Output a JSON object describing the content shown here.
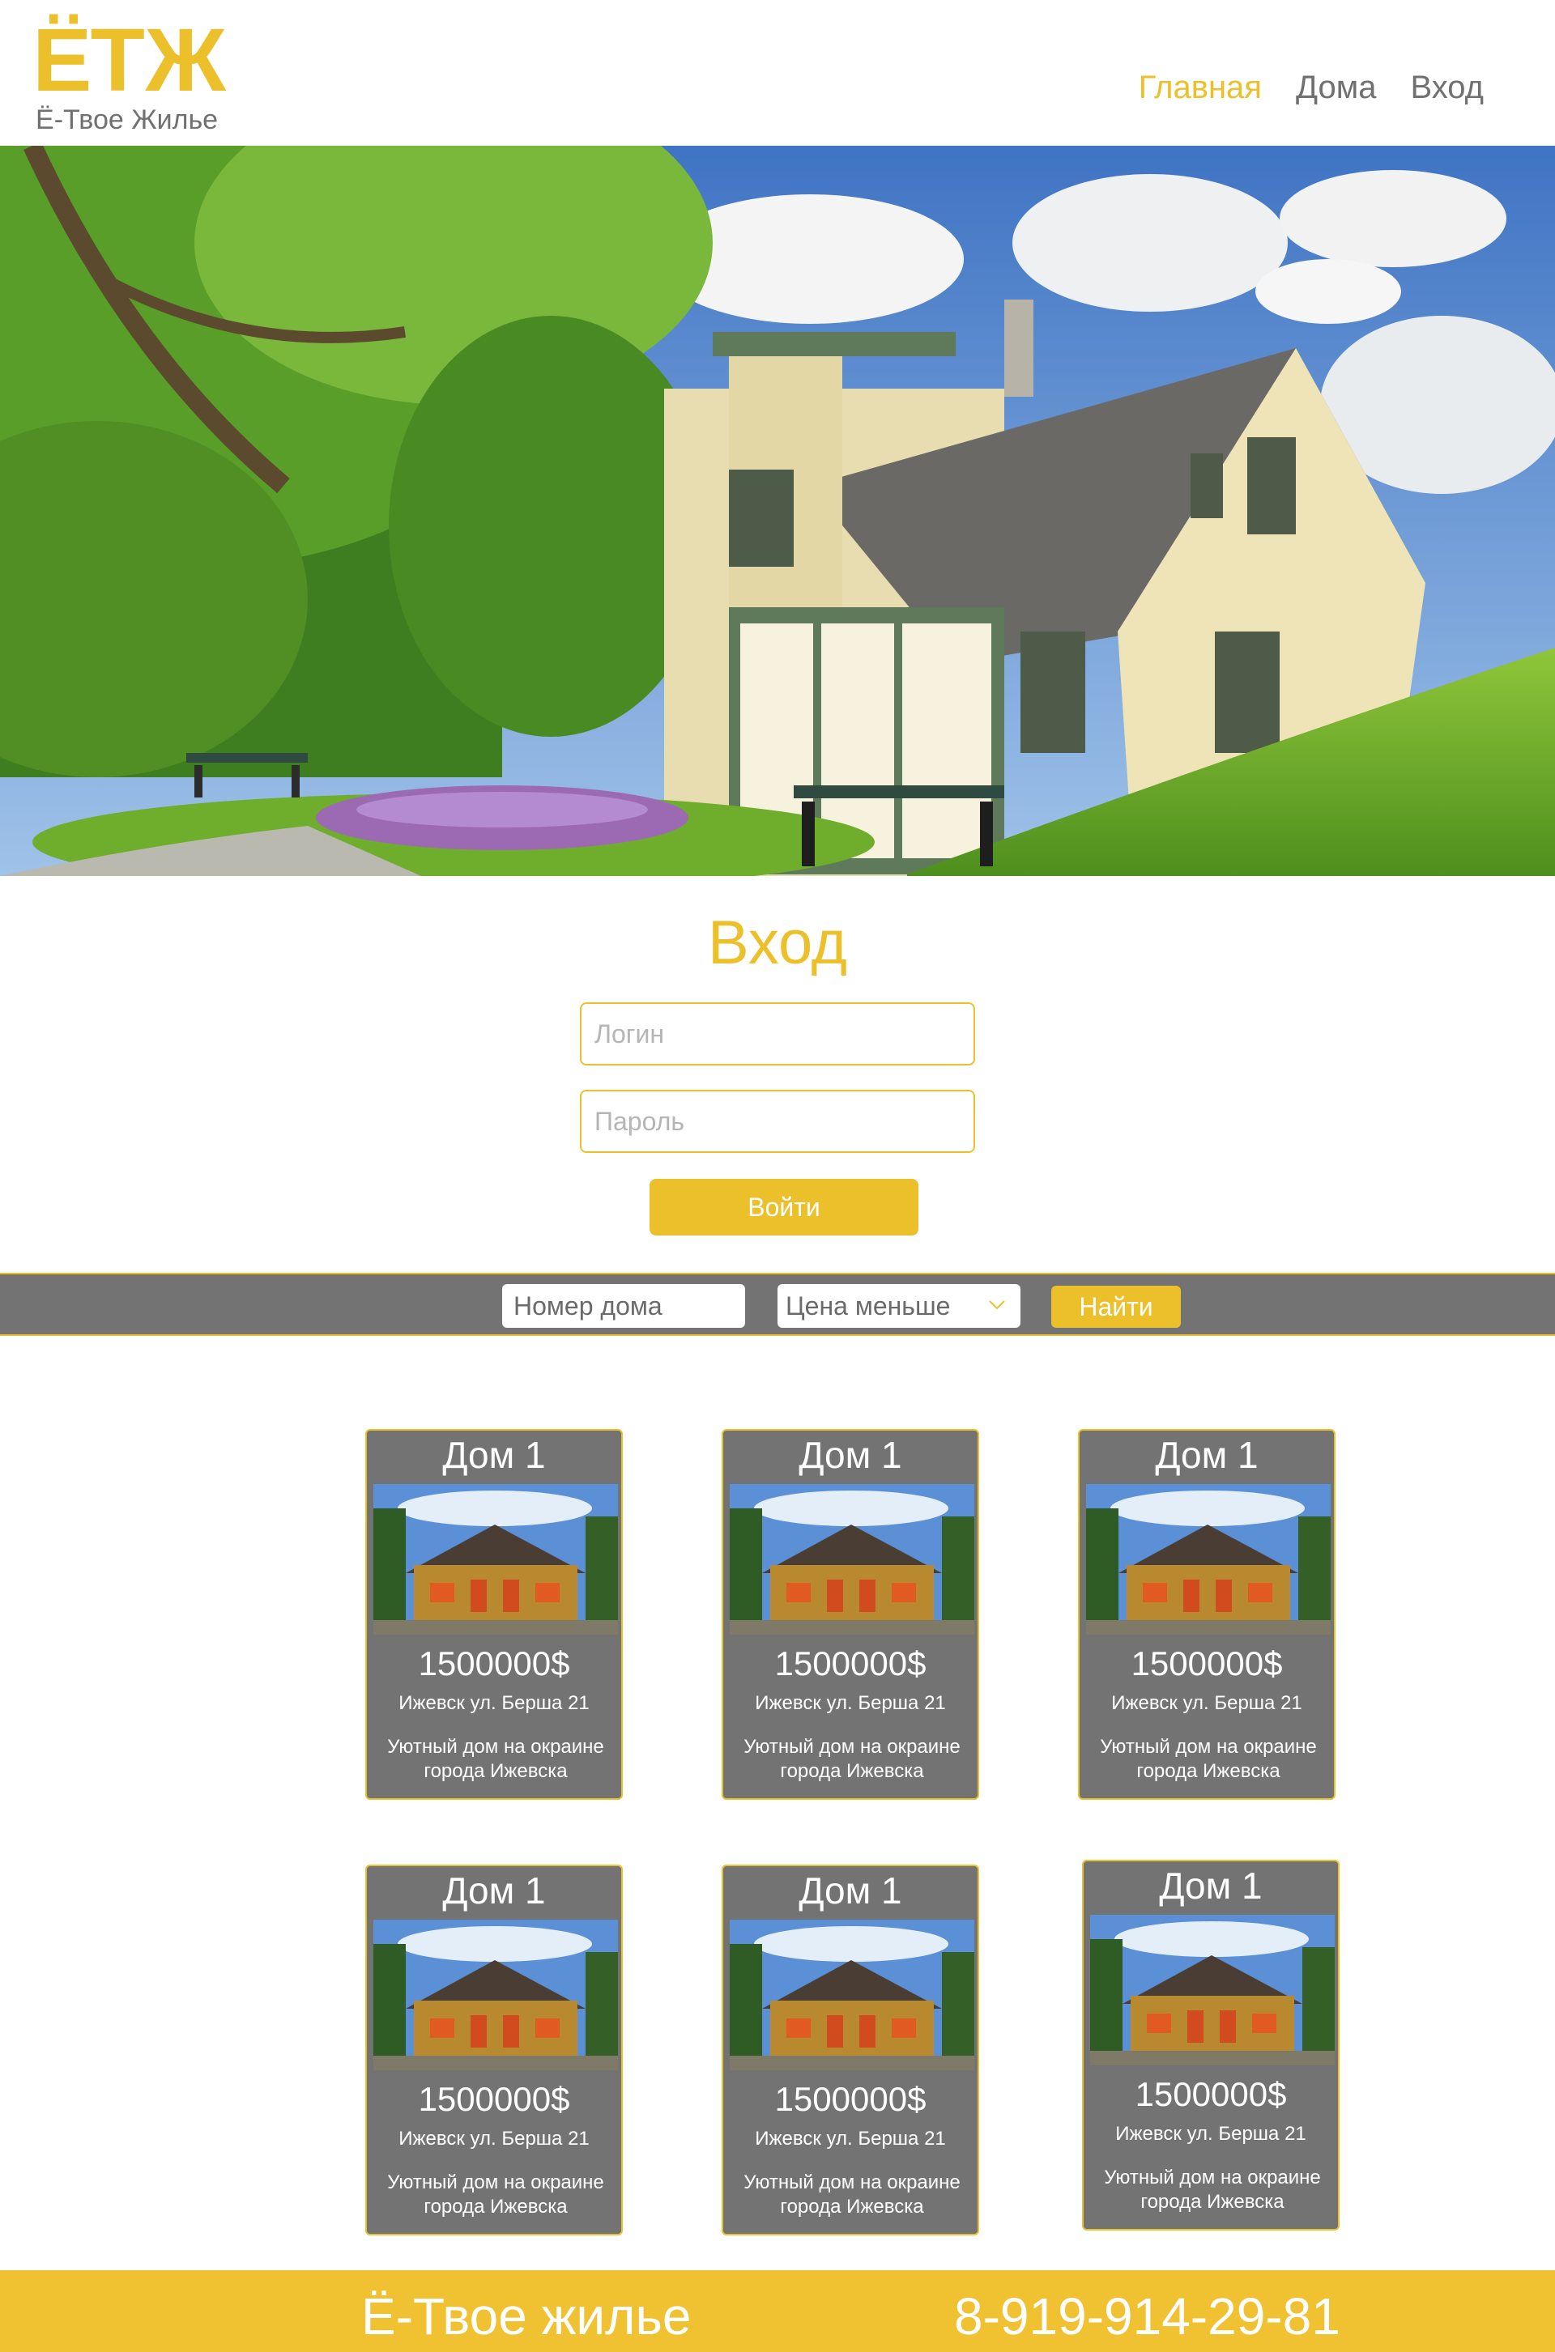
{
  "header": {
    "logo_mark": "ЁТЖ",
    "logo_sub": "Ё-Твое Жилье",
    "nav": [
      {
        "label": "Главная",
        "active": true
      },
      {
        "label": "Дома",
        "active": false
      },
      {
        "label": "Вход",
        "active": false
      }
    ]
  },
  "login": {
    "title": "Вход",
    "login_placeholder": "Логин",
    "password_placeholder": "Пароль",
    "submit_label": "Войти"
  },
  "filter": {
    "number_placeholder": "Номер дома",
    "price_select_value": "Цена меньше",
    "find_label": "Найти"
  },
  "listings": [
    {
      "title": "Дом 1",
      "price": "1500000$",
      "address": "Ижевск ул. Берша 21",
      "description": "Уютный дом на окраине города Ижевска"
    },
    {
      "title": "Дом 1",
      "price": "1500000$",
      "address": "Ижевск ул. Берша 21",
      "description": "Уютный дом на окраине города Ижевска"
    },
    {
      "title": "Дом 1",
      "price": "1500000$",
      "address": "Ижевск ул. Берша 21",
      "description": "Уютный дом на окраине города Ижевска"
    },
    {
      "title": "Дом 1",
      "price": "1500000$",
      "address": "Ижевск ул. Берша 21",
      "description": "Уютный дом на окраине города Ижевска"
    },
    {
      "title": "Дом 1",
      "price": "1500000$",
      "address": "Ижевск ул. Берша 21",
      "description": "Уютный дом на окраине города Ижевска"
    },
    {
      "title": "Дом 1",
      "price": "1500000$",
      "address": "Ижевск ул. Берша 21",
      "description": "Уютный дом на окраине города Ижевска"
    }
  ],
  "footer": {
    "brand": "Ё-Твое жилье",
    "phone": "8-919-914-29-81"
  },
  "colors": {
    "accent": "#ecc02a",
    "gray": "#737373",
    "nav_text": "#707070"
  }
}
